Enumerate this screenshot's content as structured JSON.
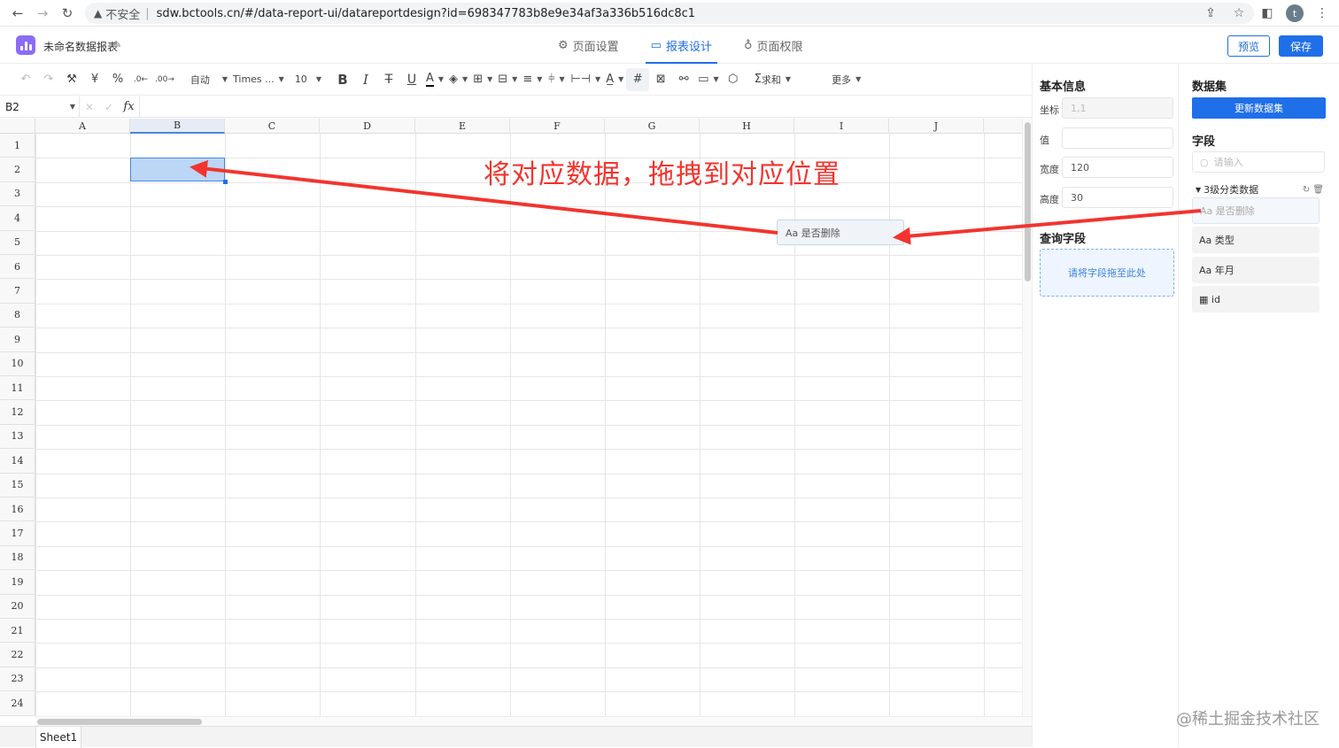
{
  "browser": {
    "security_label": "不安全",
    "url": "sdw.bctools.cn/#/data-report-ui/datareportdesign?id=698347783b8e9e34af3a336b516dc8c1",
    "avatar_letter": "t"
  },
  "app": {
    "report_name": "未命名数据报表",
    "tabs": [
      {
        "label": "页面设置",
        "icon": "⚙"
      },
      {
        "label": "报表设计",
        "icon": "▭"
      },
      {
        "label": "页面权限",
        "icon": "♁"
      }
    ],
    "preview_label": "预览",
    "save_label": "保存",
    "accent": "#1f6fe8"
  },
  "toolbar": {
    "format_auto": "自动",
    "font_name": "Times ...",
    "font_size": "10",
    "sum_label": "求和",
    "more_label": "更多"
  },
  "formula_bar": {
    "cell_ref": "B2",
    "fx_label": "fx"
  },
  "sheet": {
    "columns": [
      "A",
      "B",
      "C",
      "D",
      "E",
      "F",
      "G",
      "H",
      "I",
      "J"
    ],
    "rows": [
      "1",
      "2",
      "3",
      "4",
      "5",
      "6",
      "7",
      "8",
      "9",
      "10",
      "11",
      "12",
      "13",
      "14",
      "15",
      "16",
      "17",
      "18",
      "19",
      "20",
      "21",
      "22",
      "23",
      "24"
    ],
    "tab_name": "Sheet1"
  },
  "annotation": {
    "text": "将对应数据，拖拽到对应位置",
    "drag_chip": "Aa 是否删除",
    "color": "#f2342e"
  },
  "basic_info": {
    "title": "基本信息",
    "coord_label": "坐标",
    "coord_value": "1,1",
    "value_label": "值",
    "value_value": "",
    "width_label": "宽度",
    "width_value": "120",
    "height_label": "高度",
    "height_value": "30",
    "query_title": "查询字段",
    "dropzone_text": "请将字段拖至此处"
  },
  "dataset": {
    "title": "数据集",
    "refresh_label": "更新数据集",
    "fields_title": "字段",
    "search_placeholder": "请输入",
    "dataset_name": "3级分类数据",
    "fields": [
      {
        "label": "Aa 是否删除",
        "ghost": true
      },
      {
        "label": "Aa 类型",
        "ghost": false
      },
      {
        "label": "Aa 年月",
        "ghost": false
      },
      {
        "label": "▦ id",
        "ghost": false
      }
    ]
  },
  "watermark": "@稀土掘金技术社区"
}
